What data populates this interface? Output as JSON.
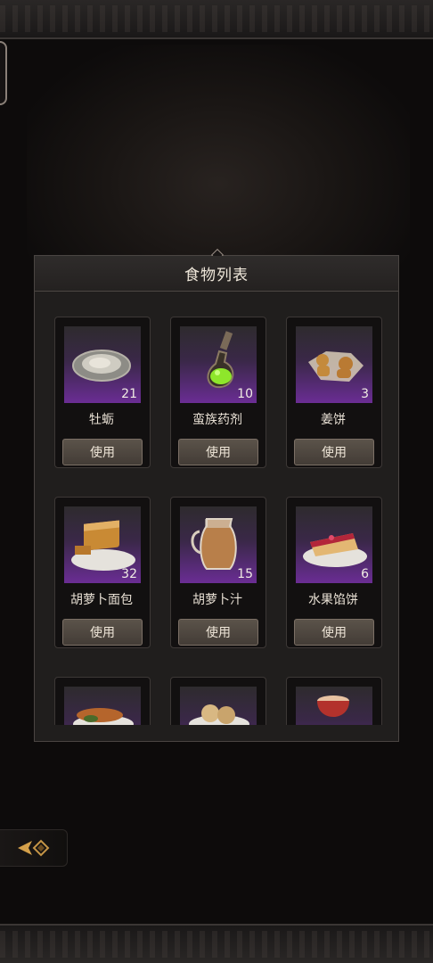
{
  "panel": {
    "title": "食物列表"
  },
  "use_label": "使用",
  "colors": {
    "thumb_purple": "#6a2d94",
    "button": "#5b534a"
  },
  "items": [
    {
      "name": "牡蛎",
      "qty": "21",
      "icon": "oyster-icon"
    },
    {
      "name": "蛮族药剂",
      "qty": "10",
      "icon": "potion-icon"
    },
    {
      "name": "姜饼",
      "qty": "3",
      "icon": "gingerbread-icon"
    },
    {
      "name": "胡萝卜面包",
      "qty": "32",
      "icon": "carrot-bread-icon"
    },
    {
      "name": "胡萝卜汁",
      "qty": "15",
      "icon": "carrot-juice-icon"
    },
    {
      "name": "水果馅饼",
      "qty": "6",
      "icon": "fruit-pie-icon"
    },
    {
      "name": "",
      "qty": "",
      "icon": "fried-fish-icon"
    },
    {
      "name": "",
      "qty": "",
      "icon": "cookies-icon"
    },
    {
      "name": "",
      "qty": "",
      "icon": "juice-cup-icon"
    }
  ]
}
